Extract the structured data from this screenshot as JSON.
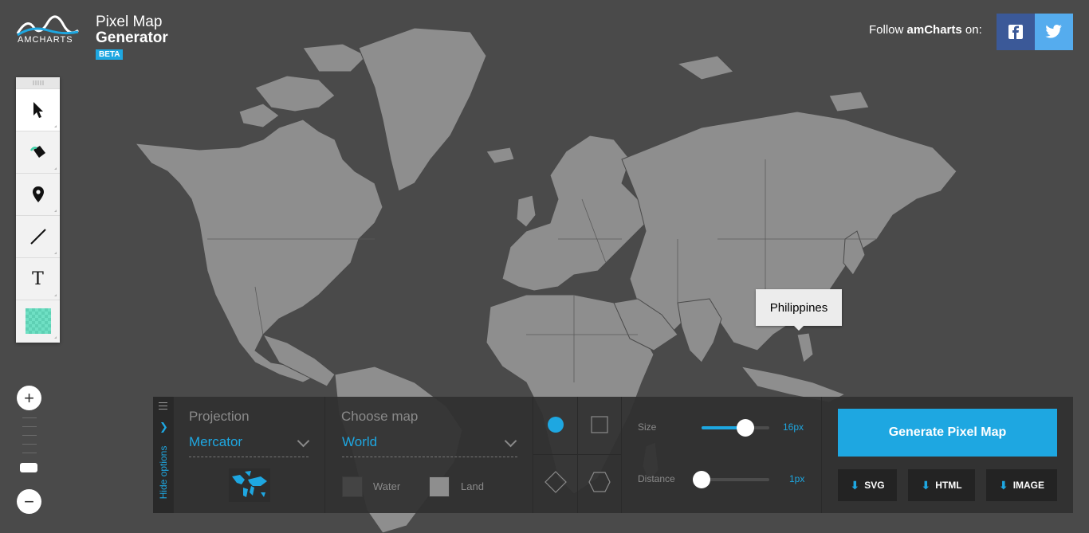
{
  "brand": {
    "logo_text": "AMCHARTS",
    "title_line1": "Pixel Map",
    "title_line2": "Generator",
    "badge": "BETA"
  },
  "social": {
    "follow_prefix": "Follow ",
    "follow_brand": "amCharts",
    "follow_suffix": " on:",
    "facebook_icon": "facebook-icon",
    "twitter_icon": "twitter-icon"
  },
  "toolbox": {
    "tools": [
      {
        "name": "pointer-tool",
        "icon": "cursor-arrow-icon"
      },
      {
        "name": "paint-tool",
        "icon": "paint-bucket-icon"
      },
      {
        "name": "marker-tool",
        "icon": "map-pin-icon"
      },
      {
        "name": "line-tool",
        "icon": "line-icon"
      },
      {
        "name": "text-tool",
        "icon": "text-icon",
        "glyph": "T"
      },
      {
        "name": "color-tool",
        "icon": "color-swatch-icon"
      }
    ]
  },
  "zoom": {
    "in_label": "+",
    "out_label": "−"
  },
  "tooltip": {
    "text": "Philippines"
  },
  "panel": {
    "hide_options_label": "Hide options",
    "projection": {
      "label": "Projection",
      "value": "Mercator"
    },
    "map": {
      "label": "Choose map",
      "value": "World"
    },
    "colors": {
      "water_label": "Water",
      "land_label": "Land",
      "water_color": "#444444",
      "land_color": "#8e8e8e"
    },
    "shapes": [
      "circle",
      "square",
      "diamond",
      "hexagon"
    ],
    "size": {
      "label": "Size",
      "value": "16px",
      "fraction": 0.65
    },
    "distance": {
      "label": "Distance",
      "value": "1px",
      "fraction": 0.0
    },
    "generate_label": "Generate Pixel Map",
    "downloads": [
      "SVG",
      "HTML",
      "IMAGE"
    ]
  },
  "colors": {
    "accent": "#1ea7e1",
    "background": "#4a4a4a",
    "land": "#8e8e8e"
  }
}
